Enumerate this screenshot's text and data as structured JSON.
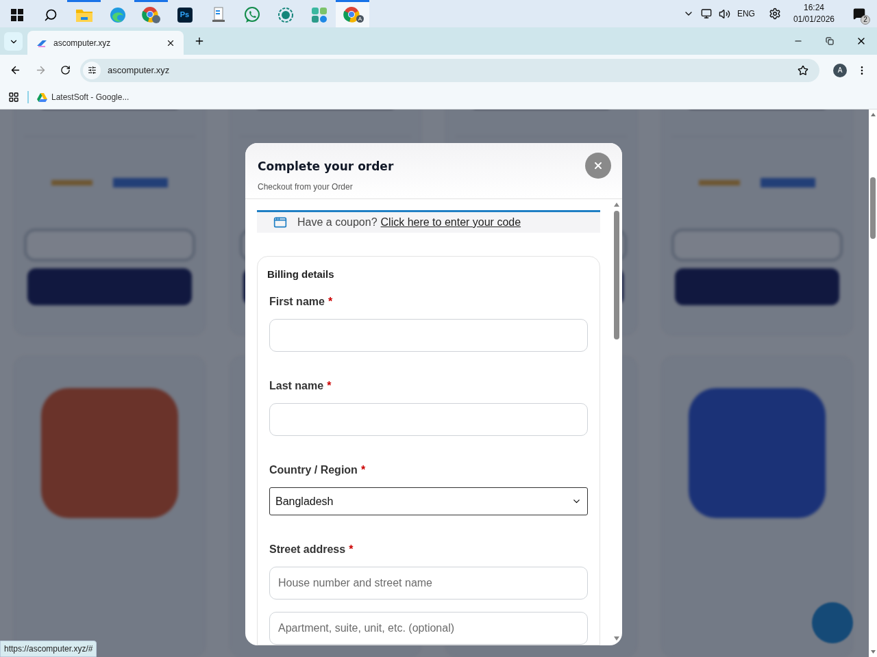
{
  "taskbar": {
    "apps": [
      {
        "kind": "start",
        "running": false,
        "selected": false
      },
      {
        "kind": "search",
        "running": false,
        "selected": false
      },
      {
        "kind": "folder",
        "running": true,
        "selected": false
      },
      {
        "kind": "edge",
        "running": false,
        "selected": false
      },
      {
        "kind": "chrome-person",
        "running": true,
        "selected": false
      },
      {
        "kind": "ps",
        "label": "Ps",
        "running": false,
        "selected": false
      },
      {
        "kind": "doc",
        "running": false,
        "selected": false
      },
      {
        "kind": "whatsapp",
        "running": false,
        "selected": false
      },
      {
        "kind": "ring",
        "running": false,
        "selected": false
      },
      {
        "kind": "tiles",
        "running": false,
        "selected": false
      },
      {
        "kind": "chrome-profile",
        "badge": "A",
        "running": true,
        "selected": true
      }
    ],
    "tray": {
      "language": "ENG",
      "time": "16:24",
      "date": "01/01/2026",
      "notifications": "2"
    }
  },
  "browser": {
    "tab": {
      "title": "ascomputer.xyz"
    },
    "address": "ascomputer.xyz",
    "profile": "A",
    "bookmarks": [
      {
        "label": "LatestSoft - Google..."
      }
    ],
    "status_url": "https://ascomputer.xyz/#"
  },
  "modal": {
    "title": "Complete your order",
    "subtitle": "Checkout from your Order",
    "coupon": {
      "text": "Have a coupon?",
      "link": "Click here to enter your code"
    },
    "billing": {
      "title": "Billing details",
      "fields": [
        {
          "kind": "text",
          "label": "First name",
          "required_mark": "*"
        },
        {
          "kind": "text",
          "label": "Last name",
          "required_mark": "*"
        },
        {
          "kind": "select",
          "label": "Country / Region",
          "required_mark": "*",
          "value": "Bangladesh"
        },
        {
          "kind": "text",
          "label": "Street address",
          "required_mark": "*",
          "placeholder": "House number and street name"
        },
        {
          "kind": "text",
          "placeholder": "Apartment, suite, unit, etc. (optional)"
        }
      ]
    }
  }
}
